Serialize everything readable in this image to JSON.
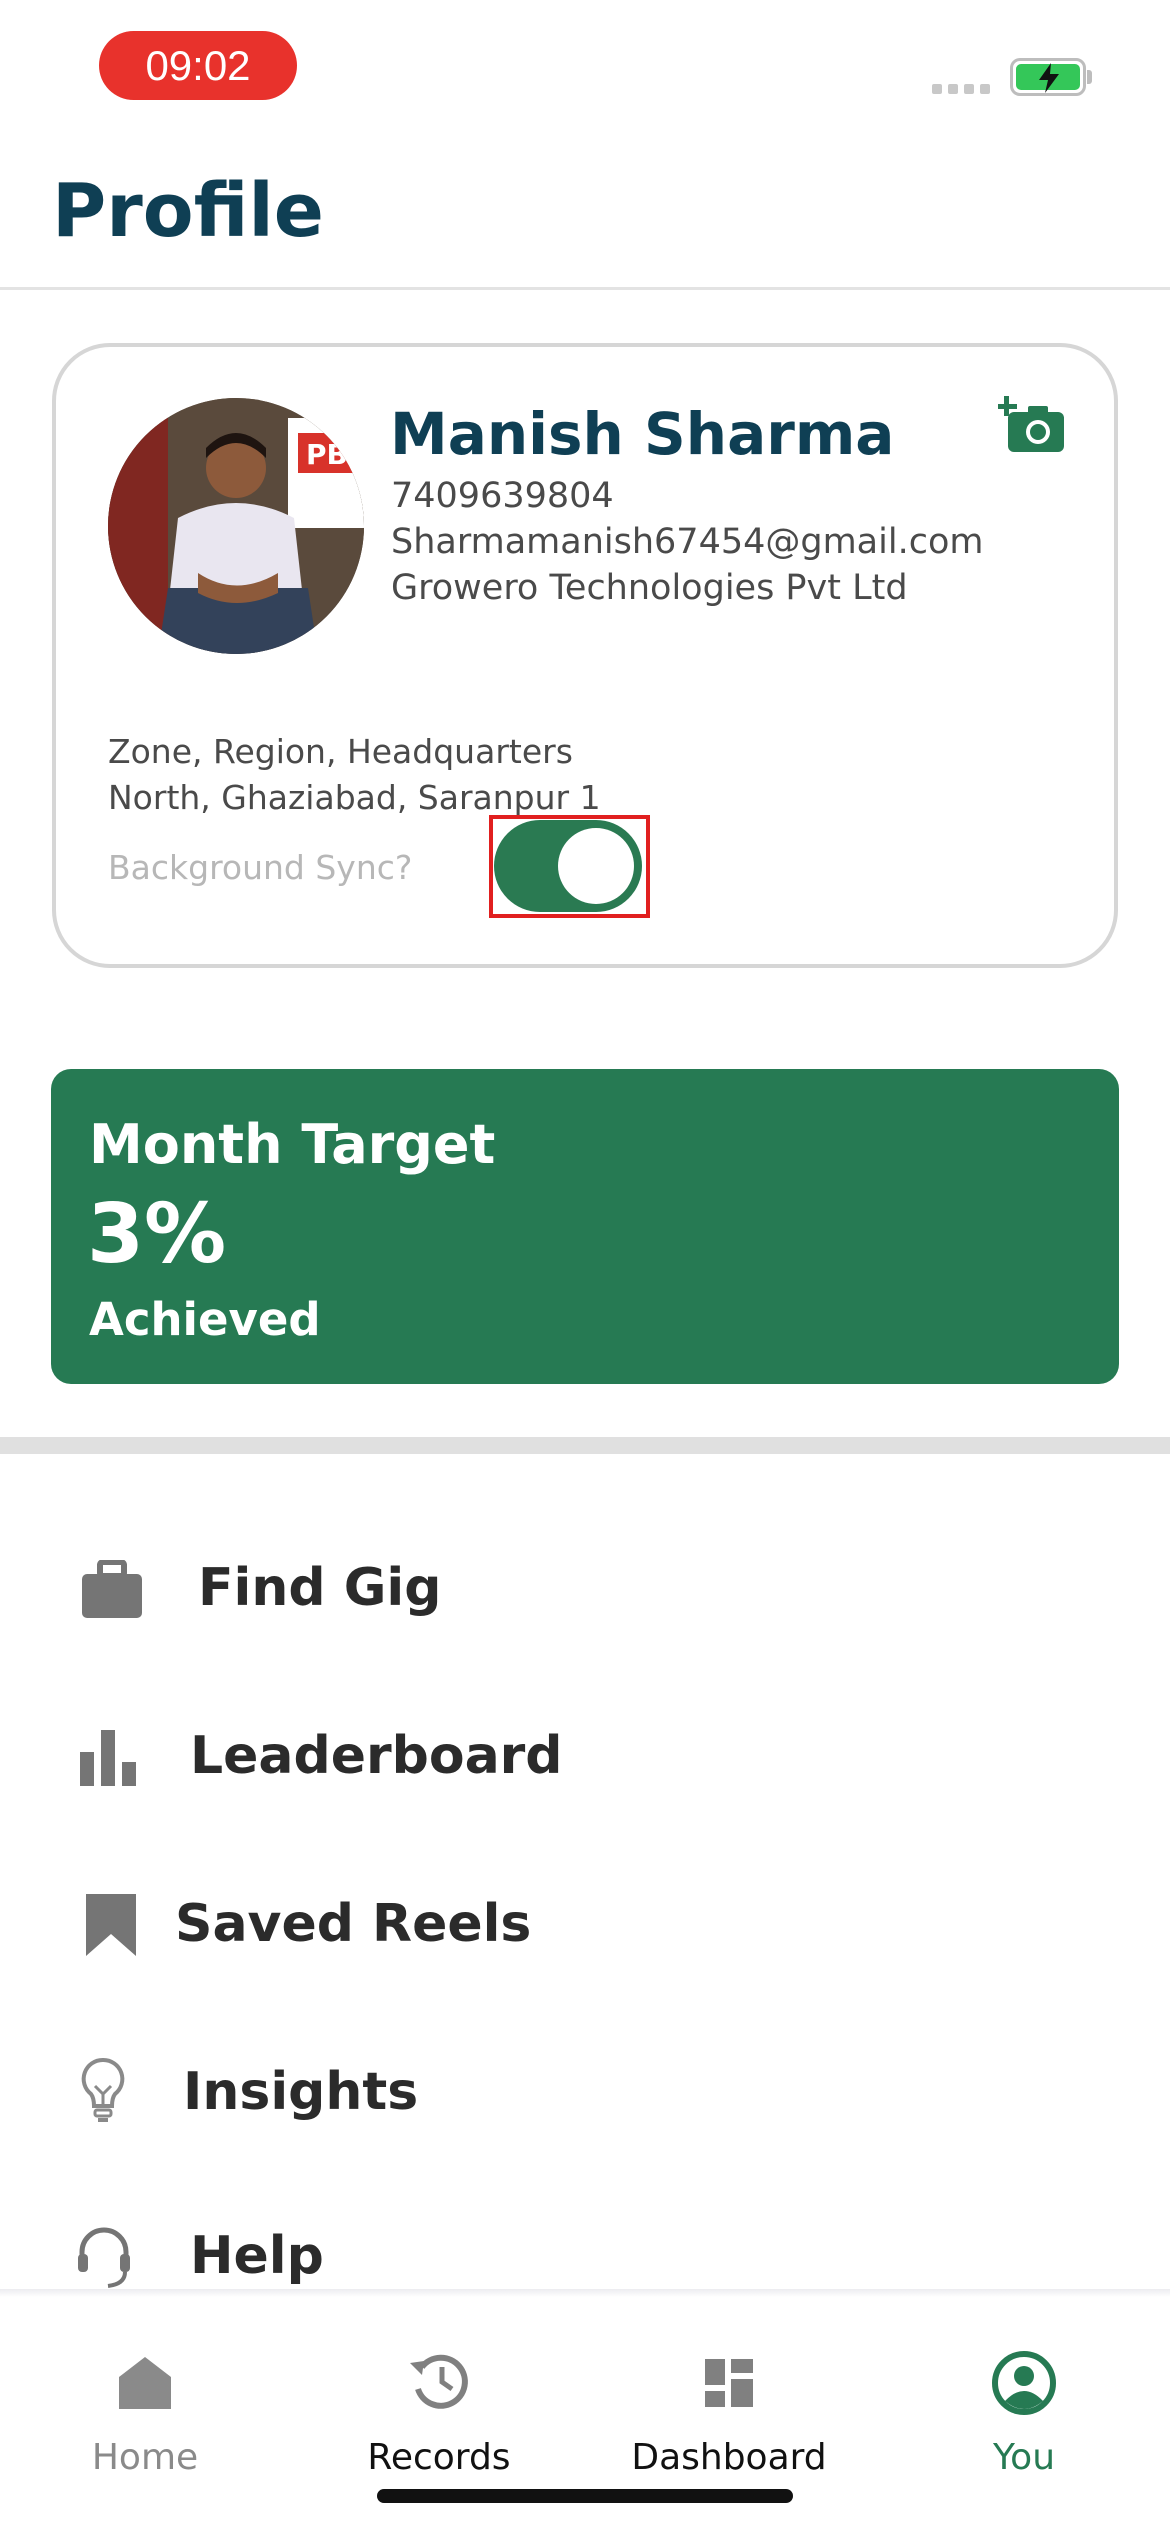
{
  "status_bar": {
    "time": "09:02"
  },
  "page": {
    "title": "Profile"
  },
  "profile": {
    "name": "Manish Sharma",
    "phone": "7409639804",
    "email": "Sharmamanish67454@gmail.com",
    "company": "Growero Technologies Pvt Ltd",
    "location_labels": "Zone, Region, Headquarters",
    "location_values": "North, Ghaziabad, Saranpur 1",
    "sync_label": "Background Sync?",
    "sync_enabled": true
  },
  "target": {
    "title": "Month Target",
    "percent": "3%",
    "status": "Achieved"
  },
  "menu": {
    "items": [
      {
        "label": "Find Gig",
        "icon": "briefcase-icon"
      },
      {
        "label": "Leaderboard",
        "icon": "bar-chart-icon"
      },
      {
        "label": "Saved Reels",
        "icon": "bookmark-icon"
      },
      {
        "label": "Insights",
        "icon": "lightbulb-icon"
      },
      {
        "label": "Help",
        "icon": "headset-icon"
      }
    ]
  },
  "bottom_nav": {
    "items": [
      {
        "label": "Home",
        "icon": "home-icon",
        "active": false
      },
      {
        "label": "Records",
        "icon": "history-icon",
        "active": false
      },
      {
        "label": "Dashboard",
        "icon": "dashboard-icon",
        "active": false
      },
      {
        "label": "You",
        "icon": "user-icon",
        "active": true
      }
    ]
  },
  "colors": {
    "brand_green": "#267a53",
    "title_navy": "#0f3f54",
    "time_pill": "#e8322c",
    "highlight": "#e11f1f"
  }
}
